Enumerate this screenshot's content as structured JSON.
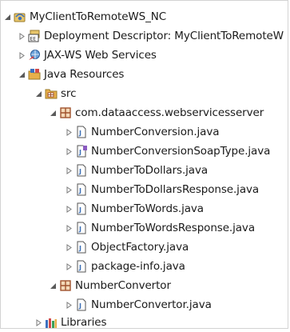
{
  "tree": {
    "project": {
      "label": "MyClientToRemoteWS_NC",
      "icon": "project-icon",
      "expanded": true
    },
    "deployment_descriptor": {
      "label": "Deployment Descriptor: MyClientToRemoteW",
      "icon": "deployment-descriptor-icon"
    },
    "jaxws": {
      "label": "JAX-WS Web Services",
      "icon": "web-services-icon"
    },
    "java_resources": {
      "label": "Java Resources",
      "icon": "java-resources-icon",
      "expanded": true
    },
    "src": {
      "label": "src",
      "icon": "source-folder-icon",
      "expanded": true
    },
    "package1": {
      "label": "com.dataaccess.webservicesserver",
      "icon": "package-icon",
      "expanded": true,
      "files": [
        {
          "label": "NumberConversion.java",
          "icon": "java-file-icon"
        },
        {
          "label": "NumberConversionSoapType.java",
          "icon": "java-interface-file-icon"
        },
        {
          "label": "NumberToDollars.java",
          "icon": "java-file-icon"
        },
        {
          "label": "NumberToDollarsResponse.java",
          "icon": "java-file-icon"
        },
        {
          "label": "NumberToWords.java",
          "icon": "java-file-icon"
        },
        {
          "label": "NumberToWordsResponse.java",
          "icon": "java-file-icon"
        },
        {
          "label": "ObjectFactory.java",
          "icon": "java-file-icon"
        },
        {
          "label": "package-info.java",
          "icon": "java-file-icon"
        }
      ]
    },
    "package2": {
      "label": "NumberConvertor",
      "icon": "package-icon",
      "expanded": true,
      "files": [
        {
          "label": "NumberConvertor.java",
          "icon": "java-file-icon"
        }
      ]
    },
    "libraries": {
      "label": "Libraries",
      "icon": "libraries-icon"
    }
  },
  "colors": {
    "twisty": "#5a5a5a",
    "package": "#a0522d",
    "java_file": "#3b6fb6",
    "folder": "#e8b04a"
  }
}
